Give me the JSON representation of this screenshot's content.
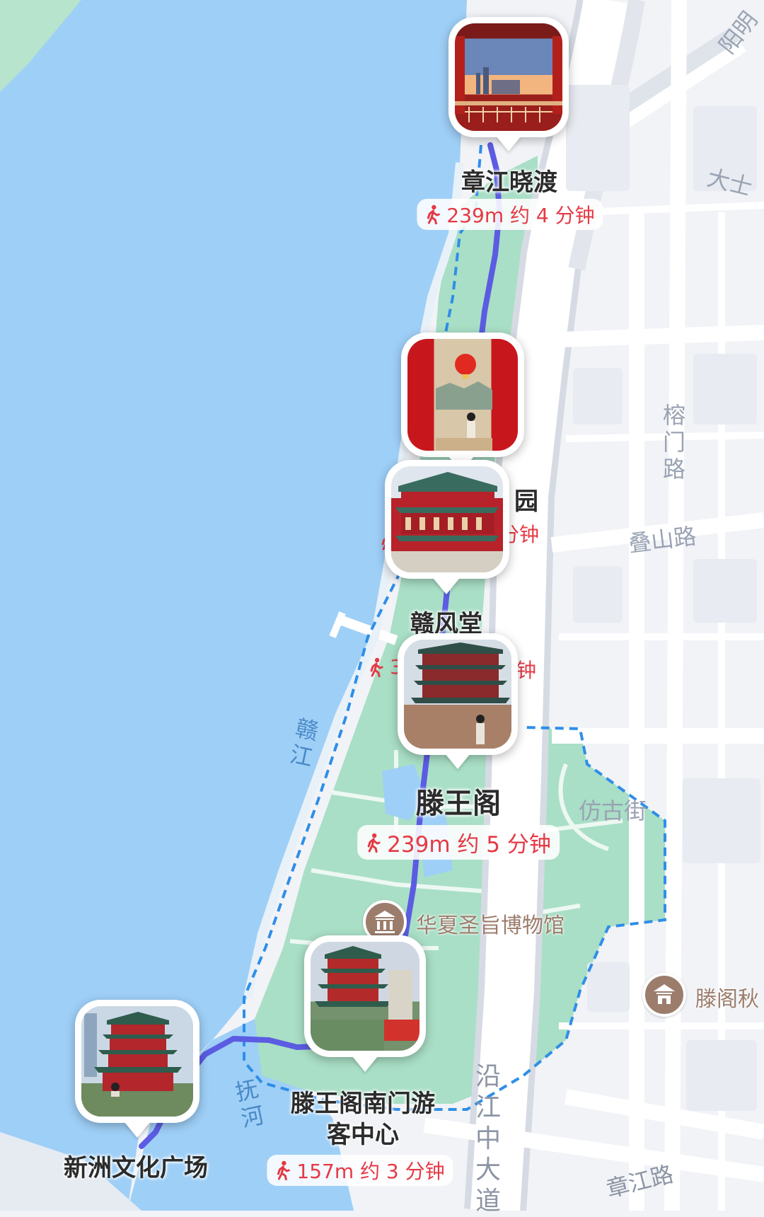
{
  "pois": [
    {
      "id": "zhangjiang-xiaodu",
      "name": "章江晓渡",
      "walk": "239m 约 4 分钟",
      "photo": "palace-window-sunset"
    },
    {
      "id": "hidden-garden",
      "name": "园",
      "walk": "分钟",
      "photo": "red-pillars-lantern"
    },
    {
      "id": "ganfeng-hall",
      "name": "赣风堂",
      "walk": "",
      "photo": "red-pavilion"
    },
    {
      "id": "tengwang-pavilion",
      "name": "滕王阁",
      "walk": "239m 约 5 分钟",
      "photo": "tengwang-pavilion-tower"
    },
    {
      "id": "south-gate-visitor-center",
      "name": "滕王阁南门游客中心",
      "name_line1": "滕王阁南门游",
      "name_line2": "客中心",
      "walk": "157m 约 3 分钟",
      "photo": "pavilion-with-tourist"
    },
    {
      "id": "xinzhou-plaza",
      "name": "新洲文化广场",
      "walk": "",
      "photo": "pavilion-front-view"
    }
  ],
  "partial_labels": {
    "walk_fragment": "3",
    "walk_fragment_2": "钟",
    "walk_fragment_3": "分钟"
  },
  "map_labels": {
    "road_top": "阳明",
    "road_dashi": "大士",
    "road_rongmen": "榕门路",
    "road_dieshan": "叠山路",
    "river_gan": "赣江",
    "river_fu": "抚河",
    "street_fanggu": "仿古街",
    "road_yanjiang": "沿江中大道",
    "road_zhangjiang": "章江路"
  },
  "museums": [
    {
      "name": "华夏圣旨博物馆",
      "icon": "museum-icon"
    },
    {
      "name": "滕阁秋",
      "icon": "museum-icon"
    }
  ],
  "colors": {
    "water": "#9ecff7",
    "park": "#a9dfc6",
    "route": "#5b5ce2",
    "walk_text": "#e53945",
    "road": "#ffffff",
    "land": "#f1f3f7",
    "museum": "#9c7d6c"
  }
}
